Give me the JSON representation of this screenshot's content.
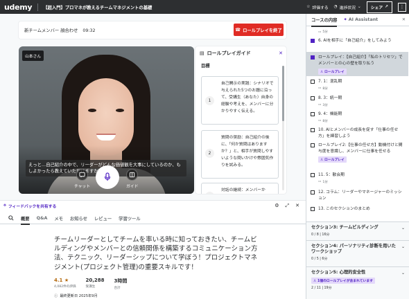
{
  "topbar": {
    "logo": "udemy",
    "course_title": "【超入門】プロマネが教えるチームマネジメントの基礎",
    "rating_label": "評価する",
    "progress_label": "進捗状況",
    "share_label": "シェア",
    "more_icon": "more-vertical-icon"
  },
  "session": {
    "meeting_title": "新チームメンバー 顔合わせ",
    "time": "09:32",
    "end_button": "ロールプレイを終了",
    "end_color": "#e02b24"
  },
  "video": {
    "name_tag": "山本さん",
    "caption": "えっと…自己紹介の中で、リーダーがどんな価値観を大事にしているのか、もしよかったら教えていただけますか？",
    "chat_label": "チャット",
    "guide_label": "ガイド"
  },
  "guide": {
    "title": "ロールプレイガイド",
    "subtitle": "目標",
    "items": [
      {
        "num": "1",
        "text": "自己開示の実践：シナリオで与えられた5つのお題に沿って、受講生（あなた）自身の経験や考えを、メンバーに分かりやすく伝える。"
      },
      {
        "num": "2",
        "text": "質問の奨励：自己紹介の後に、「何か質問はありますか？」と、相手が質問しやすいような問いかけや雰囲気作りを試みる。"
      },
      {
        "num": "3",
        "text": "対話の継続：メンバーか"
      }
    ]
  },
  "feedback": {
    "label": "フィードバックを共有する"
  },
  "tabs": [
    {
      "label": "概要",
      "active": true
    },
    {
      "label": "Q&A",
      "active": false
    },
    {
      "label": "メモ",
      "active": false
    },
    {
      "label": "お知らせ",
      "active": false
    },
    {
      "label": "レビュー",
      "active": false
    },
    {
      "label": "学習ツール",
      "active": false
    }
  ],
  "overview": {
    "description": "チームリーダーとしてチームを率いる時に知っておきたい、チームビルディングやメンバーとの信頼関係を構築するコミュニケーション方法、テクニック、リーダーシップについて学ぼう！プロジェクトマネジメント(プロジェクト管理)の重要スキルです！",
    "rating": "4.1",
    "rating_sub": "4,082件の評価",
    "students": "20,288",
    "students_sub": "受講生",
    "duration": "3時間",
    "duration_sub": "合計",
    "updated": "最終更新日 2025年9月"
  },
  "sidebar": {
    "tab_content": "コースの内容",
    "tab_ai": "AI Assistant",
    "lectures": [
      {
        "title": "",
        "duration": "5分",
        "checked": false,
        "current": false,
        "badge": ""
      },
      {
        "title": "6. AIを相手に「自己紹介」をしてみよう",
        "duration": "",
        "checked": true,
        "current": false,
        "badge": ""
      },
      {
        "title": "ロールプレイ：【自己紹介】「私のトリセツ」でメンバーとの心の壁を取り払う",
        "duration": "",
        "checked": true,
        "current": true,
        "badge": "ロールプレイ"
      },
      {
        "title": "7. 1：混乱期",
        "duration": "8分",
        "checked": false,
        "current": false,
        "badge": ""
      },
      {
        "title": "8. 3：統一期",
        "duration": "3分",
        "checked": false,
        "current": false,
        "badge": ""
      },
      {
        "title": "9. 4：機能期",
        "duration": "8分",
        "checked": false,
        "current": false,
        "badge": ""
      },
      {
        "title": "10. AIとメンバーの成長を促す「仕事の任せ方」を練習しよう",
        "duration": "",
        "checked": false,
        "current": false,
        "badge": ""
      },
      {
        "title": "ロールプレイ2:【仕事の任せ方】動機付けと間与度を意識し、メンバーに仕事を任せる",
        "duration": "",
        "checked": false,
        "current": false,
        "badge": "ロールプレイ"
      },
      {
        "title": "11. 5：散会期",
        "duration": "1分",
        "checked": false,
        "current": false,
        "badge": ""
      },
      {
        "title": "12. コラム：リーダーやマネージャーのミッション",
        "duration": "",
        "checked": false,
        "current": false,
        "badge": ""
      },
      {
        "title": "13. このセクションのまとめ",
        "duration": "",
        "checked": false,
        "current": false,
        "badge": ""
      }
    ],
    "sections": [
      {
        "title": "セクション3: チームビルディング",
        "meta": "0 / 8 | 16分",
        "badge": ""
      },
      {
        "title": "セクション4: パーソナリティ診断を用いたワークショップ",
        "meta": "0 / 5 | 6分",
        "badge": ""
      },
      {
        "title": "セクション5: 心理的安全性",
        "meta": "2 / 11 | 19分",
        "badge": "1個のロールプレイが含まれています"
      }
    ]
  }
}
